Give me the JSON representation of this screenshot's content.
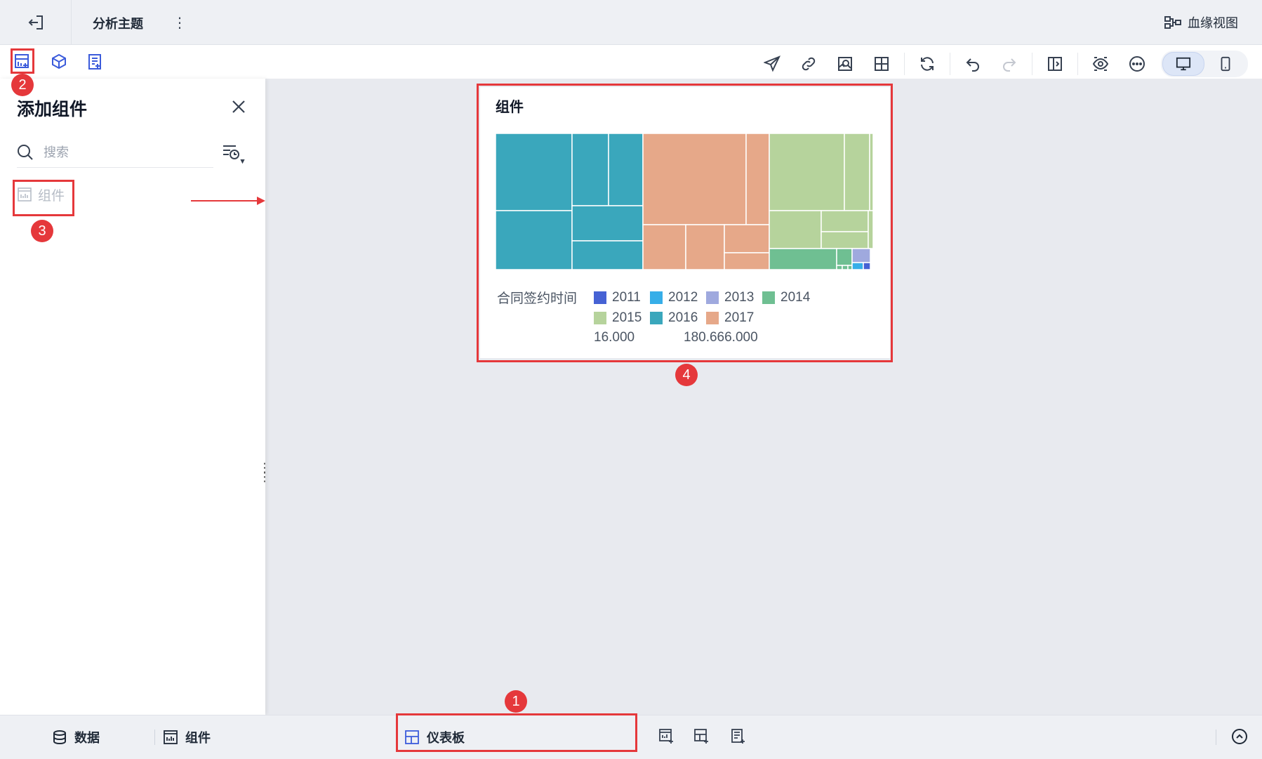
{
  "topbar": {
    "title": "分析主题",
    "more": "⋮",
    "lineage_label": "血缘视图"
  },
  "panel": {
    "title": "添加组件",
    "search_placeholder": "搜索",
    "items": [
      {
        "label": "组件"
      }
    ]
  },
  "widget": {
    "title": "组件",
    "chart_data": {
      "type": "treemap",
      "title": "组件",
      "legend_title": "合同签约时间",
      "legend": [
        {
          "name": "2011",
          "color": "#4662d4"
        },
        {
          "name": "2012",
          "color": "#36aee8"
        },
        {
          "name": "2013",
          "color": "#9fa9de"
        },
        {
          "name": "2014",
          "color": "#6fbf92"
        },
        {
          "name": "2015",
          "color": "#b6d39c"
        },
        {
          "name": "2016",
          "color": "#3aa7bc"
        },
        {
          "name": "2017",
          "color": "#e6a889"
        }
      ],
      "range_min": "16.000",
      "range_max": "180.666.000"
    }
  },
  "bottombar": {
    "tabs": {
      "data": "数据",
      "widgets": "组件",
      "dashboard": "仪表板"
    }
  },
  "annotations": {
    "badge1": "1",
    "badge2": "2",
    "badge3": "3",
    "badge4": "4"
  },
  "colors": {
    "accent": "#3b5bdb",
    "highlight": "#e5383b"
  }
}
